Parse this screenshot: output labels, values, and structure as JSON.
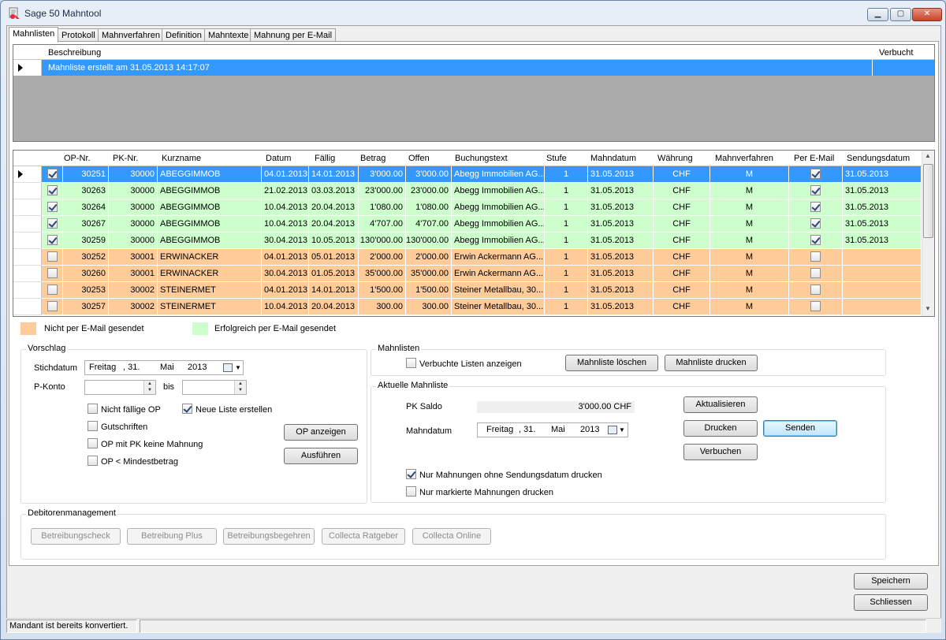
{
  "window": {
    "title": "Sage 50 Mahntool",
    "min": "▁",
    "max": "▢",
    "close": "✕"
  },
  "tabs": [
    "Mahnlisten",
    "Protokoll",
    "Mahnverfahren",
    "Definition",
    "Mahntexte",
    "Mahnung per E-Mail"
  ],
  "list_grid": {
    "headers": {
      "beschreibung": "Beschreibung",
      "verbucht": "Verbucht"
    },
    "row": {
      "beschreibung": "Mahnliste erstellt am 31.05.2013 14:17:07",
      "verbucht": ""
    }
  },
  "op_grid": {
    "headers": [
      "OP-Nr.",
      "PK-Nr.",
      "Kurzname",
      "Datum",
      "Fällig",
      "Betrag",
      "Offen",
      "Buchungstext",
      "Stufe",
      "Mahndatum",
      "Währung",
      "Mahnverfahren",
      "Per E-Mail",
      "Sendungsdatum"
    ],
    "rows": [
      {
        "checked": true,
        "op": "30251",
        "pk": "30000",
        "name": "ABEGGIMMOB",
        "datum": "04.01.2013",
        "faellig": "14.01.2013",
        "betrag": "3'000.00",
        "offen": "3'000.00",
        "text": "Abegg Immobilien AG...",
        "stufe": "1",
        "mahndatum": "31.05.2013",
        "waehrung": "CHF",
        "verfahren": "M",
        "email": true,
        "sendung": "31.05.2013",
        "status": "sel"
      },
      {
        "checked": true,
        "op": "30263",
        "pk": "30000",
        "name": "ABEGGIMMOB",
        "datum": "21.02.2013",
        "faellig": "03.03.2013",
        "betrag": "23'000.00",
        "offen": "23'000.00",
        "text": "Abegg Immobilien AG...",
        "stufe": "1",
        "mahndatum": "31.05.2013",
        "waehrung": "CHF",
        "verfahren": "M",
        "email": true,
        "sendung": "31.05.2013",
        "status": "green"
      },
      {
        "checked": true,
        "op": "30264",
        "pk": "30000",
        "name": "ABEGGIMMOB",
        "datum": "10.04.2013",
        "faellig": "20.04.2013",
        "betrag": "1'080.00",
        "offen": "1'080.00",
        "text": "Abegg Immobilien AG...",
        "stufe": "1",
        "mahndatum": "31.05.2013",
        "waehrung": "CHF",
        "verfahren": "M",
        "email": true,
        "sendung": "31.05.2013",
        "status": "green"
      },
      {
        "checked": true,
        "op": "30267",
        "pk": "30000",
        "name": "ABEGGIMMOB",
        "datum": "10.04.2013",
        "faellig": "20.04.2013",
        "betrag": "4'707.00",
        "offen": "4'707.00",
        "text": "Abegg Immobilien AG...",
        "stufe": "1",
        "mahndatum": "31.05.2013",
        "waehrung": "CHF",
        "verfahren": "M",
        "email": true,
        "sendung": "31.05.2013",
        "status": "green"
      },
      {
        "checked": true,
        "op": "30259",
        "pk": "30000",
        "name": "ABEGGIMMOB",
        "datum": "30.04.2013",
        "faellig": "10.05.2013",
        "betrag": "130'000.00",
        "offen": "130'000.00",
        "text": "Abegg Immobilien AG...",
        "stufe": "1",
        "mahndatum": "31.05.2013",
        "waehrung": "CHF",
        "verfahren": "M",
        "email": true,
        "sendung": "31.05.2013",
        "status": "green"
      },
      {
        "checked": false,
        "op": "30252",
        "pk": "30001",
        "name": "ERWINACKER",
        "datum": "04.01.2013",
        "faellig": "05.01.2013",
        "betrag": "2'000.00",
        "offen": "2'000.00",
        "text": "Erwin Ackermann AG...",
        "stufe": "1",
        "mahndatum": "31.05.2013",
        "waehrung": "CHF",
        "verfahren": "M",
        "email": false,
        "sendung": "",
        "status": "orange"
      },
      {
        "checked": false,
        "op": "30260",
        "pk": "30001",
        "name": "ERWINACKER",
        "datum": "30.04.2013",
        "faellig": "01.05.2013",
        "betrag": "35'000.00",
        "offen": "35'000.00",
        "text": "Erwin Ackermann AG...",
        "stufe": "1",
        "mahndatum": "31.05.2013",
        "waehrung": "CHF",
        "verfahren": "M",
        "email": false,
        "sendung": "",
        "status": "orange"
      },
      {
        "checked": false,
        "op": "30253",
        "pk": "30002",
        "name": "STEINERMET",
        "datum": "04.01.2013",
        "faellig": "14.01.2013",
        "betrag": "1'500.00",
        "offen": "1'500.00",
        "text": "Steiner Metallbau, 30...",
        "stufe": "1",
        "mahndatum": "31.05.2013",
        "waehrung": "CHF",
        "verfahren": "M",
        "email": false,
        "sendung": "",
        "status": "orange"
      },
      {
        "checked": false,
        "op": "30257",
        "pk": "30002",
        "name": "STEINERMET",
        "datum": "10.04.2013",
        "faellig": "20.04.2013",
        "betrag": "300.00",
        "offen": "300.00",
        "text": "Steiner Metallbau, 30...",
        "stufe": "1",
        "mahndatum": "31.05.2013",
        "waehrung": "CHF",
        "verfahren": "M",
        "email": false,
        "sendung": "",
        "status": "orange"
      }
    ]
  },
  "legend": {
    "orange": {
      "label": "Nicht per E-Mail gesendet",
      "color": "#ffcc99"
    },
    "green": {
      "label": "Erfolgreich per E-Mail gesendet",
      "color": "#ccffcc"
    }
  },
  "vorschlag": {
    "title": "Vorschlag",
    "stichdatum_label": "Stichdatum",
    "stichdatum": {
      "day_name": "Freitag",
      "day": ", 31.",
      "month": "Mai",
      "year": "2013"
    },
    "pkonto_label": "P-Konto",
    "bis_label": "bis",
    "pkonto_from": "",
    "pkonto_to": "",
    "checks": {
      "nicht_faellig": {
        "label": "Nicht fällige OP",
        "checked": false
      },
      "neue_liste": {
        "label": "Neue Liste erstellen",
        "checked": true
      },
      "gutschriften": {
        "label": "Gutschriften",
        "checked": false
      },
      "pk_keine": {
        "label": "OP mit PK keine Mahnung",
        "checked": false
      },
      "mindest": {
        "label": "OP < Mindestbetrag",
        "checked": false
      }
    },
    "op_anzeigen": "OP anzeigen",
    "ausfuehren": "Ausführen"
  },
  "mahnlisten": {
    "title": "Mahnlisten",
    "verbuchte": {
      "label": "Verbuchte Listen anzeigen",
      "checked": false
    },
    "loeschen": "Mahnliste löschen",
    "drucken": "Mahnliste drucken"
  },
  "aktuelle": {
    "title": "Aktuelle Mahnliste",
    "pk_saldo_label": "PK Saldo",
    "pk_saldo": "3'000.00 CHF",
    "mahndatum_label": "Mahndatum",
    "mahndatum": {
      "day_name": "Freitag",
      "day": ", 31.",
      "month": "Mai",
      "year": "2013"
    },
    "aktualisieren": "Aktualisieren",
    "drucken": "Drucken",
    "senden": "Senden",
    "verbuchen": "Verbuchen",
    "nur_ohne": {
      "label": "Nur Mahnungen ohne Sendungsdatum drucken",
      "checked": true
    },
    "nur_markiert": {
      "label": "Nur markierte Mahnungen drucken",
      "checked": false
    }
  },
  "debitoren": {
    "title": "Debitorenmanagement",
    "buttons": [
      "Betreibungscheck",
      "Betreibung Plus",
      "Betreibungsbegehren",
      "Collecta Ratgeber",
      "Collecta Online"
    ]
  },
  "footer": {
    "speichern": "Speichern",
    "schliessen": "Schliessen"
  },
  "status": {
    "text": "Mandant ist bereits konvertiert."
  }
}
